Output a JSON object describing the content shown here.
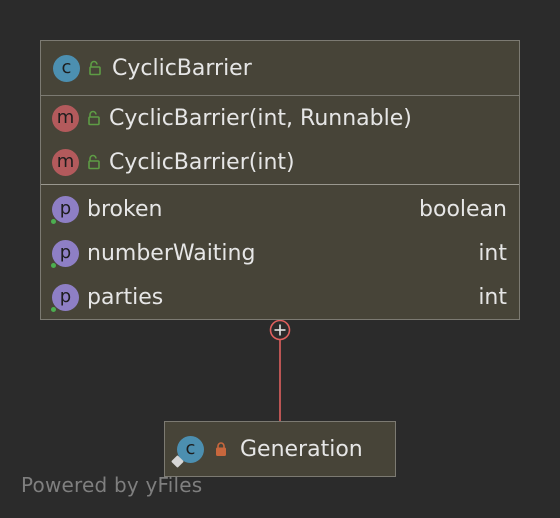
{
  "main_class": {
    "badge": "c",
    "name": "CyclicBarrier",
    "visibility_icon": "unlocked-icon",
    "constructors": [
      {
        "badge": "m",
        "signature": "CyclicBarrier(int, Runnable)",
        "visibility_icon": "unlocked-icon"
      },
      {
        "badge": "m",
        "signature": "CyclicBarrier(int)",
        "visibility_icon": "unlocked-icon"
      }
    ],
    "fields": [
      {
        "badge": "p",
        "name": "broken",
        "type": "boolean"
      },
      {
        "badge": "p",
        "name": "numberWaiting",
        "type": "int"
      },
      {
        "badge": "p",
        "name": "parties",
        "type": "int"
      }
    ]
  },
  "inner_class": {
    "badge": "c",
    "name": "Generation",
    "visibility_icon": "locked-icon"
  },
  "connector": {
    "type": "inner-class-association",
    "color": "#e0605e"
  },
  "watermark": "Powered by yFiles",
  "colors": {
    "background": "#2b2b2b",
    "box_fill": "#474438",
    "box_border": "#7c7a72",
    "class_badge": "#4c8fb0",
    "method_badge": "#b35a5c",
    "property_badge": "#8e7fc5",
    "public_lock": "#5e9c45",
    "private_lock": "#c8673d"
  }
}
